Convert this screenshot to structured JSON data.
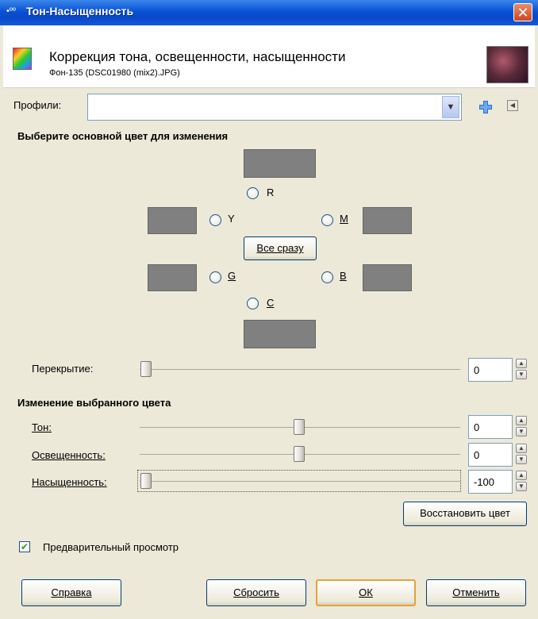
{
  "window": {
    "title": "Тон-Насыщенность",
    "close": "✕"
  },
  "header": {
    "title": "Коррекция тона, освещенности, насыщенности",
    "subtitle": "Фон-135 (DSC01980 (mix2).JPG)"
  },
  "profiles": {
    "label": "Профили:",
    "value": ""
  },
  "select_section": {
    "title": "Выберите основной цвет для изменения"
  },
  "colors": {
    "r": "R",
    "y": "Y",
    "m": "M",
    "g": "G",
    "b": "B",
    "c": "C",
    "all_button": "Все сразу"
  },
  "overlap": {
    "label": "Перекрытие:",
    "value": "0"
  },
  "edit_section": {
    "title": "Изменение выбранного цвета"
  },
  "hue": {
    "label": "Тон:",
    "value": "0"
  },
  "lightness": {
    "label": "Освещенность:",
    "value": "0"
  },
  "saturation": {
    "label": "Насыщенность:",
    "value": "-100"
  },
  "reset_color_button": "Восстановить цвет",
  "preview": {
    "label": "Предварительный просмотр",
    "checked": true
  },
  "buttons": {
    "help": "Справка",
    "reset": "Сбросить",
    "ok": "ОК",
    "cancel": "Отменить"
  }
}
